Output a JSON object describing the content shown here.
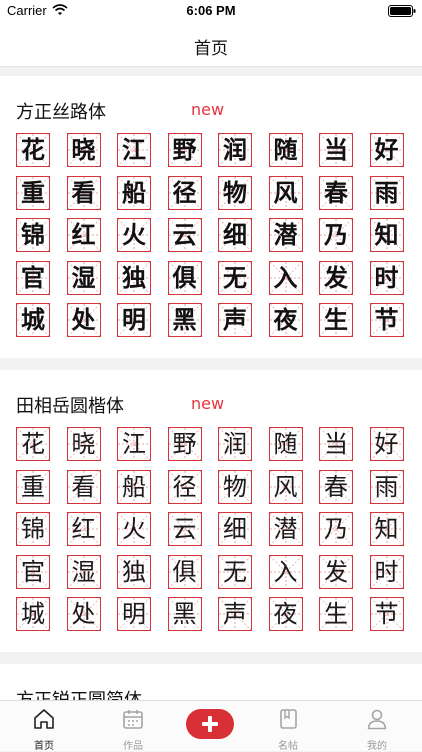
{
  "status_bar": {
    "carrier": "Carrier",
    "time": "6:06 PM"
  },
  "nav": {
    "title": "首页"
  },
  "sections": [
    {
      "title": "方正丝路体",
      "badge": "new",
      "style": "bold",
      "chars": [
        "花",
        "晓",
        "江",
        "野",
        "润",
        "随",
        "当",
        "好",
        "重",
        "看",
        "船",
        "径",
        "物",
        "风",
        "春",
        "雨",
        "锦",
        "红",
        "火",
        "云",
        "细",
        "潜",
        "乃",
        "知",
        "官",
        "湿",
        "独",
        "俱",
        "无",
        "入",
        "发",
        "时",
        "城",
        "处",
        "明",
        "黑",
        "声",
        "夜",
        "生",
        "节"
      ]
    },
    {
      "title": "田相岳圆楷体",
      "badge": "new",
      "style": "brush",
      "chars": [
        "花",
        "晓",
        "江",
        "野",
        "润",
        "随",
        "当",
        "好",
        "重",
        "看",
        "船",
        "径",
        "物",
        "风",
        "春",
        "雨",
        "锦",
        "红",
        "火",
        "云",
        "细",
        "潜",
        "乃",
        "知",
        "官",
        "湿",
        "独",
        "俱",
        "无",
        "入",
        "发",
        "时",
        "城",
        "处",
        "明",
        "黑",
        "声",
        "夜",
        "生",
        "节"
      ]
    },
    {
      "title": "方正锐正圆简体",
      "badge": "",
      "style": "bold",
      "chars": []
    }
  ],
  "tabbar": {
    "items": [
      {
        "label": "首页",
        "icon": "home-icon",
        "active": true
      },
      {
        "label": "作品",
        "icon": "calendar-icon",
        "active": false
      },
      {
        "label": "",
        "icon": "plus-icon",
        "active": false
      },
      {
        "label": "名帖",
        "icon": "book-icon",
        "active": false
      },
      {
        "label": "我的",
        "icon": "person-icon",
        "active": false
      }
    ]
  },
  "colors": {
    "accent": "#d92f36",
    "grid": "#d6343d",
    "badge": "#e5343d"
  }
}
